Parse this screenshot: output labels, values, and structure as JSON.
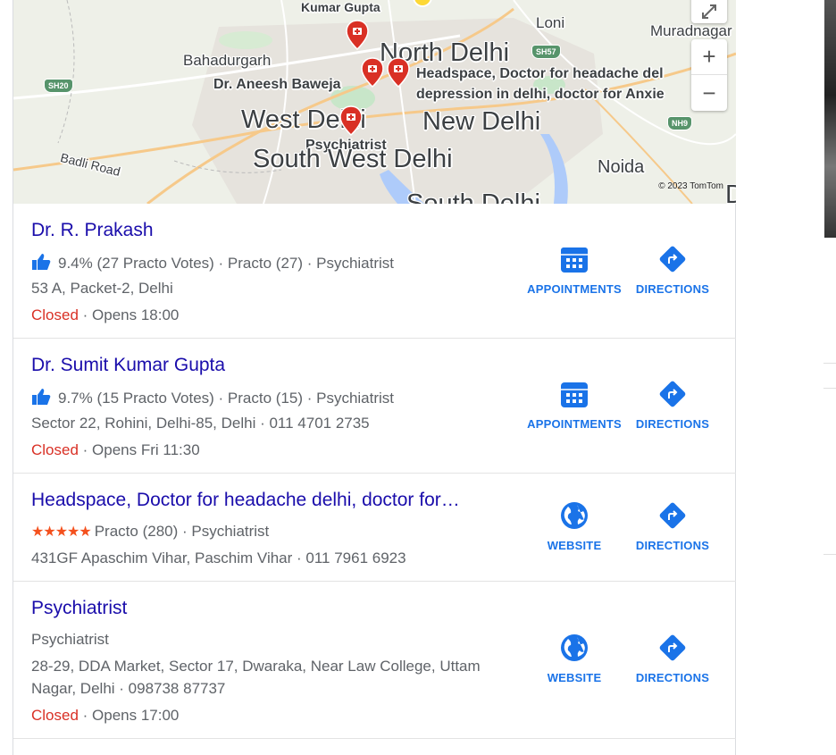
{
  "map": {
    "labels": {
      "kumar_gupta": "Kumar Gupta",
      "loni": "Loni",
      "muradnagar": "Muradnagar",
      "bahadurgarh": "Bahadurgarh",
      "north_delhi": "North Delhi",
      "aneesh": "Dr. Aneesh Baweja",
      "headspace": "Headspace, Doctor for headache del",
      "headspace2": "depression in delhi, doctor for Anxie",
      "west_delhi": "West Delhi",
      "new_delhi": "New Delhi",
      "psychiatrist": "Psychiatrist",
      "south_west_delhi": "South West Delhi",
      "noida": "Noida",
      "badli_road": "Badli Road",
      "south_delhi_partial": "South Delhi",
      "d_partial": "D"
    },
    "shields": {
      "sh20": "SH20",
      "sh57": "SH57",
      "nh9": "NH9"
    },
    "controls": {
      "zoom_in": "+",
      "zoom_out": "−"
    },
    "copyright": "© 2023 TomTom",
    "colors": {
      "pin": "#d93025",
      "water": "#aecbfa",
      "park": "#c8e6c9"
    }
  },
  "listings": [
    {
      "name": "Dr. R. Prakash",
      "rating_line": "9.4% (27 Practo Votes) · Practo (27) · Psychiatrist",
      "address": "53 A, Packet-2, Delhi",
      "status": "Closed",
      "hours": " · Opens 18:00",
      "action1": "APPOINTMENTS",
      "action2": "DIRECTIONS"
    },
    {
      "name": "Dr. Sumit Kumar Gupta",
      "rating_line": "9.7% (15 Practo Votes) · Practo (15) · Psychiatrist",
      "address": "Sector 22, Rohini, Delhi-85, Delhi · 011 4701 2735",
      "status": "Closed",
      "hours": " · Opens Fri 11:30",
      "action1": "APPOINTMENTS",
      "action2": "DIRECTIONS"
    },
    {
      "name": "Headspace, Doctor for headache delhi, doctor for…",
      "stars": "★★★★★",
      "rating": 5,
      "rating_line": "Practo (280) · Psychiatrist",
      "address": "431GF Apaschim Vihar, Paschim Vihar · 011 7961 6923",
      "action1": "WEBSITE",
      "action2": "DIRECTIONS"
    },
    {
      "name": "Psychiatrist",
      "category": "Psychiatrist",
      "address1": "28-29, DDA Market, Sector 17, Dwaraka, Near Law College, Uttam",
      "address2": "Nagar, Delhi · 098738 87737",
      "status": "Closed",
      "hours": " · Opens 17:00",
      "action1": "WEBSITE",
      "action2": "DIRECTIONS"
    }
  ],
  "accent": "#1a73e8",
  "link_color": "#1a0dab",
  "closed_color": "#d93025"
}
